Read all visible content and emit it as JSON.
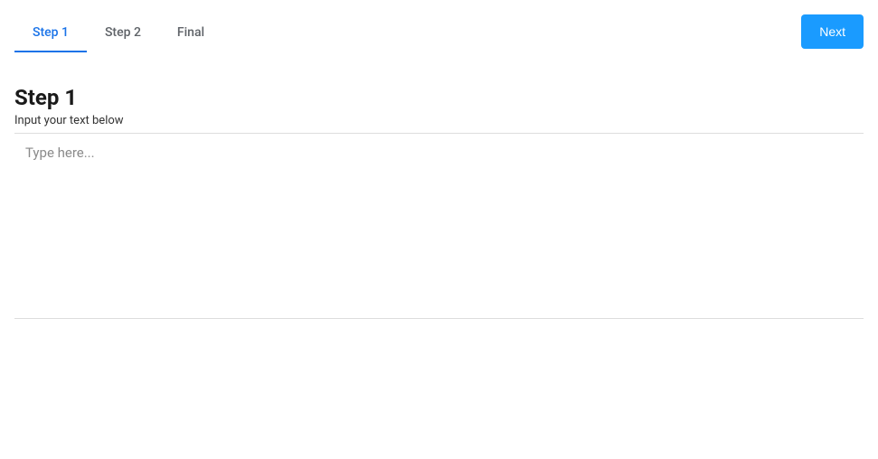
{
  "tabs": [
    {
      "label": "Step 1",
      "active": true
    },
    {
      "label": "Step 2",
      "active": false
    },
    {
      "label": "Final",
      "active": false
    }
  ],
  "actions": {
    "next_label": "Next"
  },
  "step": {
    "title": "Step 1",
    "subtitle": "Input your text below",
    "input_placeholder": "Type here...",
    "input_value": ""
  }
}
